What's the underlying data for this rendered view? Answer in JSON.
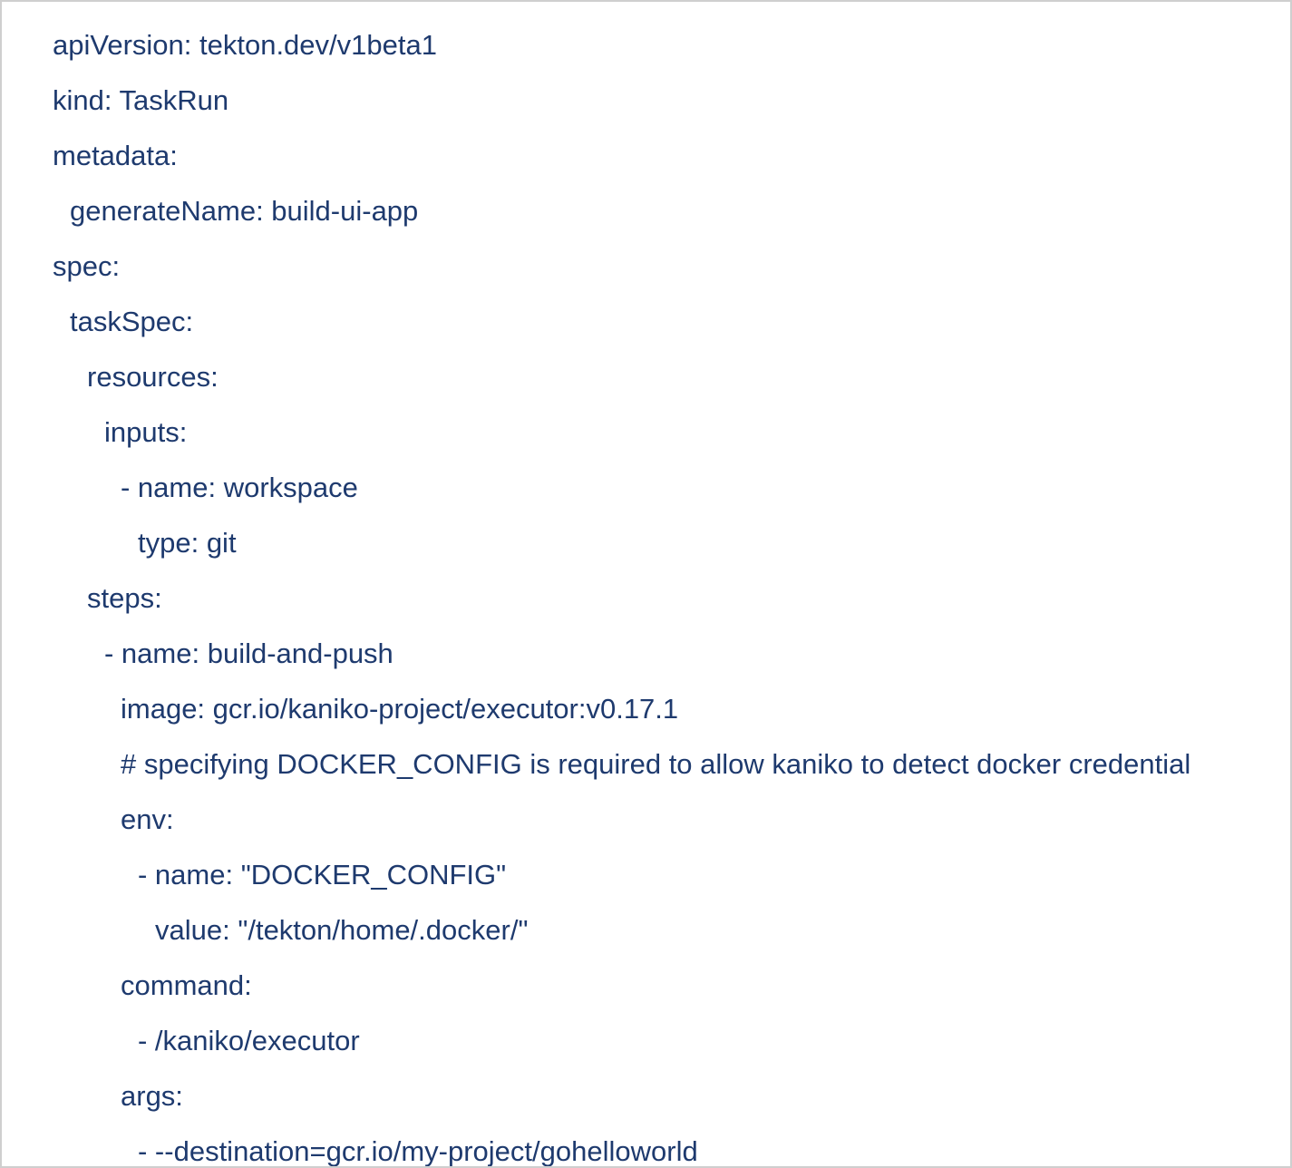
{
  "document": {
    "lines": [
      "apiVersion: tekton.dev/v1beta1",
      "kind: TaskRun",
      "metadata:",
      "generateName: build-ui-app",
      "spec:",
      "taskSpec:",
      "resources:",
      "inputs:",
      "- name: workspace",
      "type: git",
      "steps:",
      "- name: build-and-push",
      "image: gcr.io/kaniko-project/executor:v0.17.1",
      "# specifying DOCKER_CONFIG is required to allow kaniko to detect docker credential",
      "env:",
      "- name: \"DOCKER_CONFIG\"",
      "value: \"/tekton/home/.docker/\"",
      "command:",
      "- /kaniko/executor",
      "args:",
      "- --destination=gcr.io/my-project/gohelloworld"
    ]
  },
  "colors": {
    "text": "#1e3a6e",
    "border": "#cfcfcf",
    "background": "#ffffff"
  }
}
